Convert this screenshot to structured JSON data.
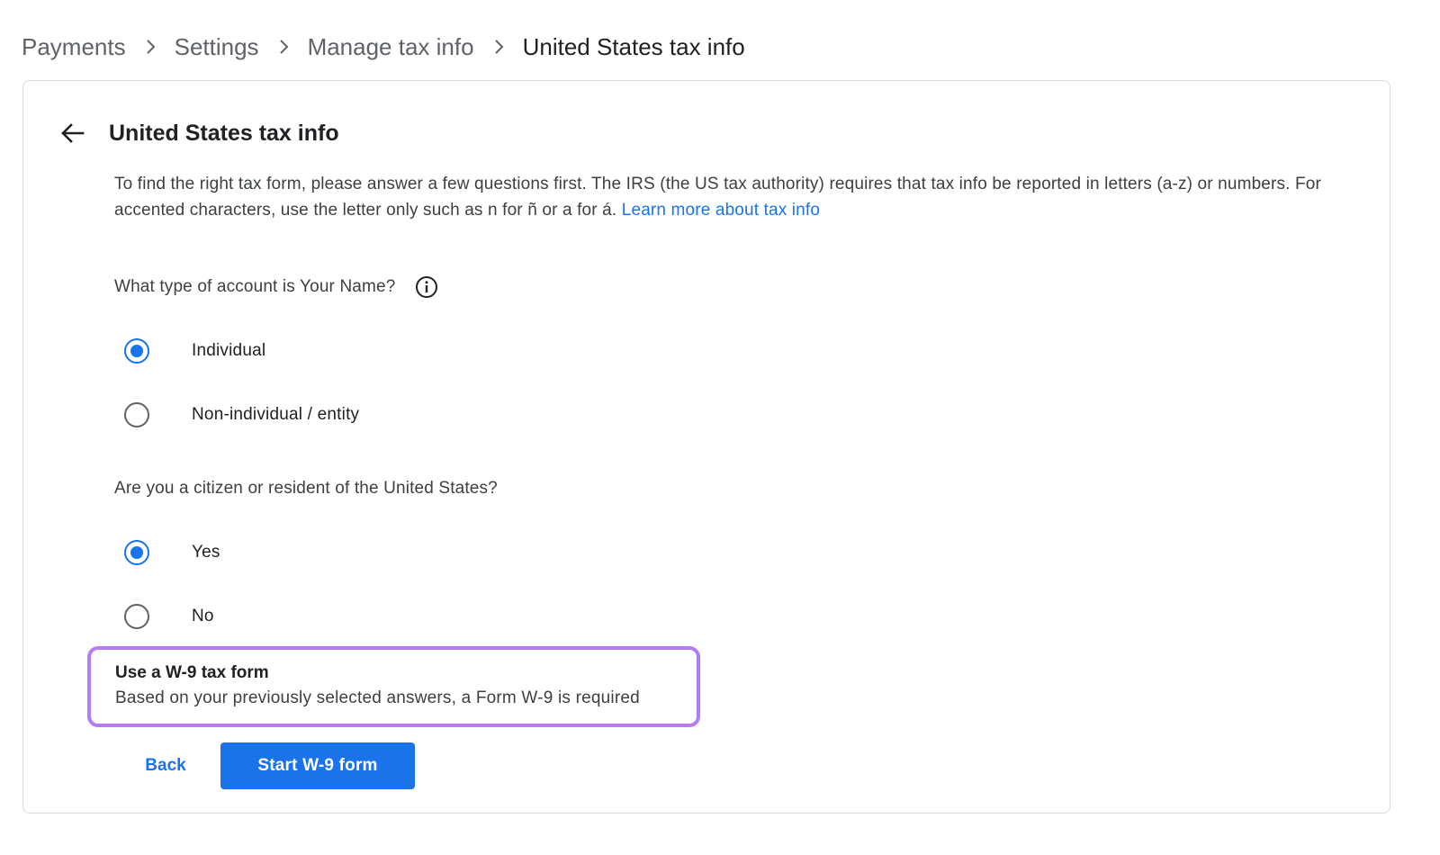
{
  "breadcrumb": {
    "items": [
      "Payments",
      "Settings",
      "Manage tax info",
      "United States tax info"
    ],
    "separator_icon": "chevron-right-icon"
  },
  "card": {
    "back_icon": "arrow-left-icon",
    "title": "United States tax info",
    "intro_text": "To find the right tax form, please answer a few questions first. The IRS (the US tax authority) requires that tax info be reported in letters (a-z) or numbers. For accented characters, use the letter only such as n for ñ or a for á. ",
    "learn_more_link": "Learn more about tax info"
  },
  "questions": [
    {
      "text": "What type of account is Your Name?",
      "info_icon": "info-icon",
      "options": [
        {
          "label": "Individual",
          "selected": true
        },
        {
          "label": "Non-individual / entity",
          "selected": false
        }
      ]
    },
    {
      "text": "Are you a citizen or resident of the United States?",
      "options": [
        {
          "label": "Yes",
          "selected": true
        },
        {
          "label": "No",
          "selected": false
        }
      ]
    }
  ],
  "notice": {
    "title": "Use a W-9 tax form",
    "text": "Based on your previously selected answers, a Form W-9 is required"
  },
  "actions": {
    "back_label": "Back",
    "start_label": "Start W-9 form"
  },
  "colors": {
    "accent": "#1a73e8",
    "notice_border": "#b57cf0",
    "card_border": "#dadce0"
  }
}
